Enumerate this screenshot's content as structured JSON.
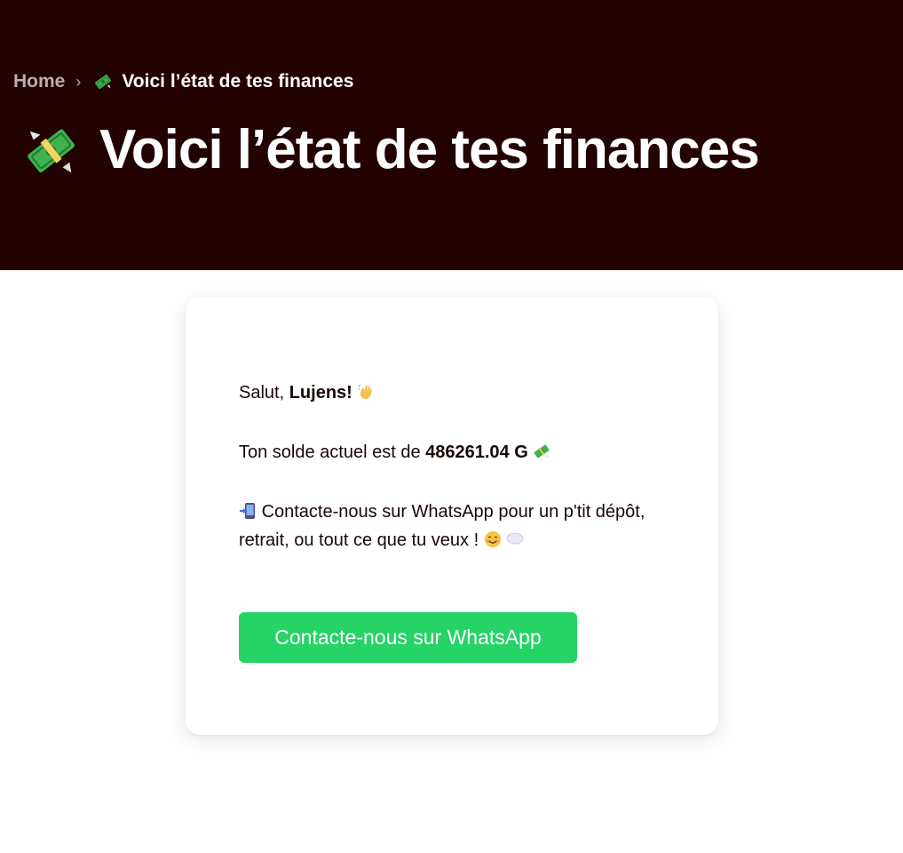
{
  "breadcrumb": {
    "home_label": "Home",
    "separator": "›",
    "current_label": "Voici l’état de tes finances",
    "current_icon": "flying-money-icon"
  },
  "header": {
    "title": "Voici l’état de tes finances",
    "title_icon": "flying-money-icon",
    "background_color": "#230202"
  },
  "card": {
    "greeting_prefix": "Salut, ",
    "user_name": "Lujens!",
    "greeting_icon": "waving-hand-icon",
    "balance_prefix": "Ton solde actuel est de ",
    "balance_value": "486261.04 G",
    "balance_icon": "flying-money-icon",
    "contact_icon": "mobile-arrow-icon",
    "contact_text": "Contacte-nous sur WhatsApp pour un p'tit dépôt, retrait, ou tout ce que tu veux !",
    "contact_icons": [
      "smiling-face-icon",
      "speech-bubble-icon"
    ],
    "button_label": "Contacte-nous sur WhatsApp",
    "button_color": "#25d366"
  }
}
